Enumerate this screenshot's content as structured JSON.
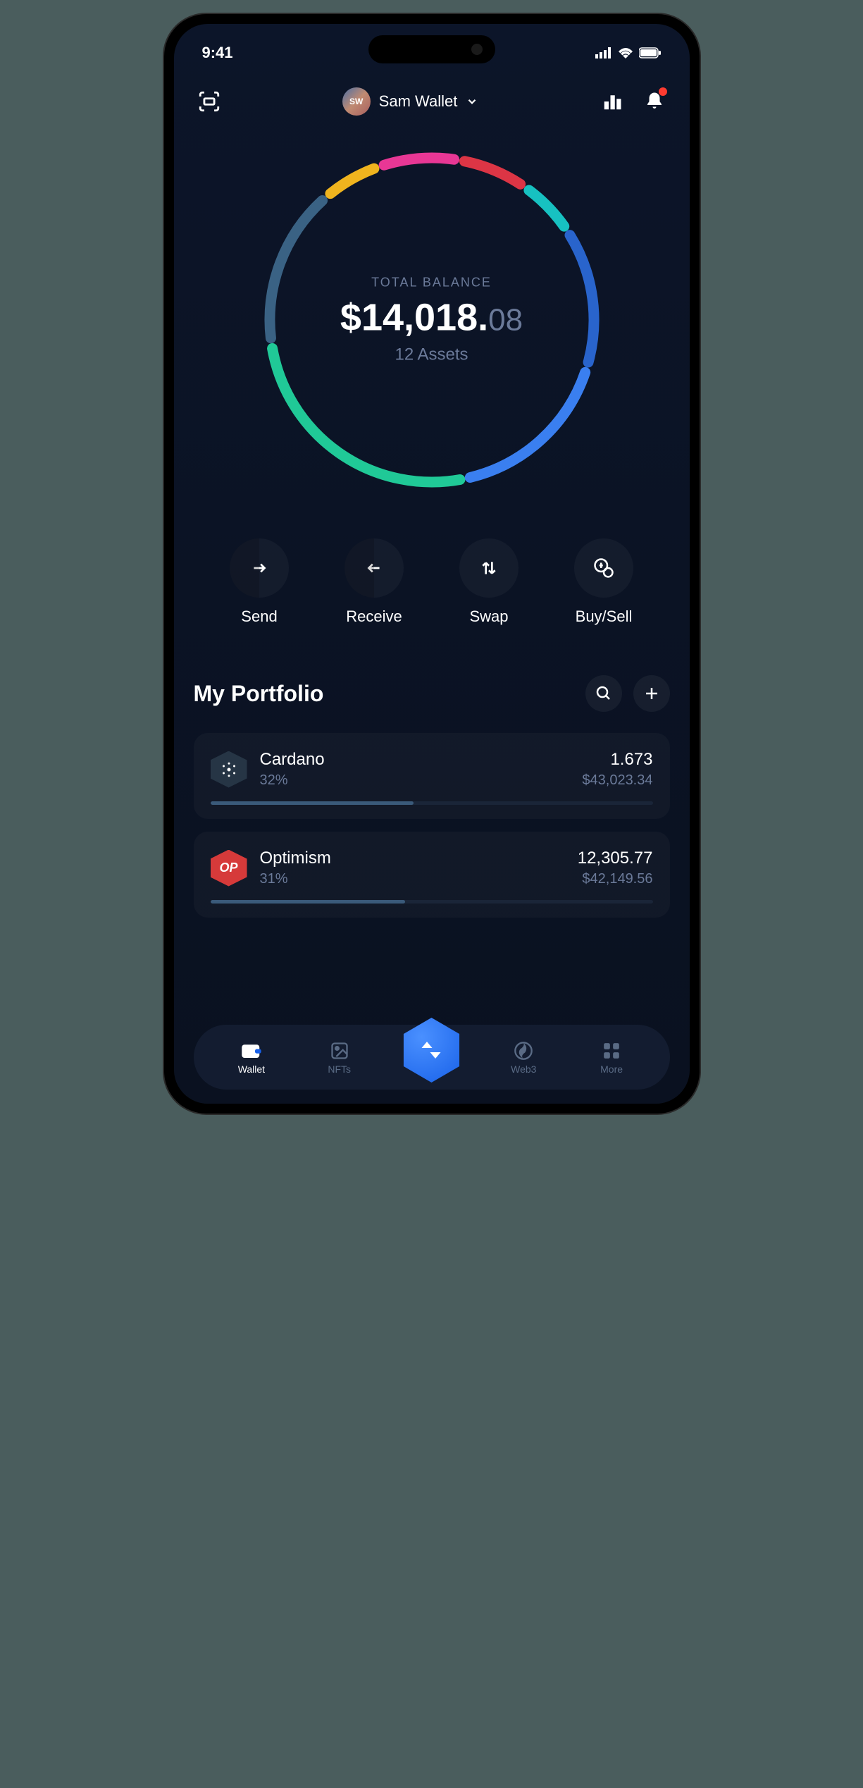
{
  "status": {
    "time": "9:41"
  },
  "header": {
    "wallet_initials": "SW",
    "wallet_name": "Sam Wallet"
  },
  "balance": {
    "label": "TOTAL BALANCE",
    "whole": "$14,018.",
    "cents": "08",
    "assets": "12 Assets"
  },
  "donut_segments": [
    {
      "color": "#20c997",
      "percent": 26
    },
    {
      "color": "#3a6284",
      "percent": 16
    },
    {
      "color": "#f0b41e",
      "percent": 6
    },
    {
      "color": "#e83795",
      "percent": 8
    },
    {
      "color": "#dc3545",
      "percent": 7
    },
    {
      "color": "#17c1c1",
      "percent": 6
    },
    {
      "color": "#2964cc",
      "percent": 14
    },
    {
      "color": "#3a7ff0",
      "percent": 17
    }
  ],
  "actions": [
    {
      "label": "Send",
      "icon": "arrow-right"
    },
    {
      "label": "Receive",
      "icon": "arrow-left"
    },
    {
      "label": "Swap",
      "icon": "arrows-updown"
    },
    {
      "label": "Buy/Sell",
      "icon": "coin"
    }
  ],
  "portfolio": {
    "title": "My Portfolio",
    "assets": [
      {
        "name": "Cardano",
        "percent": "32%",
        "qty": "1.673",
        "usd": "$43,023.34",
        "bar_pct": 46,
        "icon": "ada"
      },
      {
        "name": "Optimism",
        "percent": "31%",
        "qty": "12,305.77",
        "usd": "$42,149.56",
        "bar_pct": 44,
        "icon": "op"
      }
    ]
  },
  "nav": [
    {
      "label": "Wallet",
      "icon": "wallet",
      "active": true
    },
    {
      "label": "NFTs",
      "icon": "image",
      "active": false
    },
    {
      "label": "",
      "icon": "center",
      "active": false
    },
    {
      "label": "Web3",
      "icon": "globe",
      "active": false
    },
    {
      "label": "More",
      "icon": "grid",
      "active": false
    }
  ]
}
